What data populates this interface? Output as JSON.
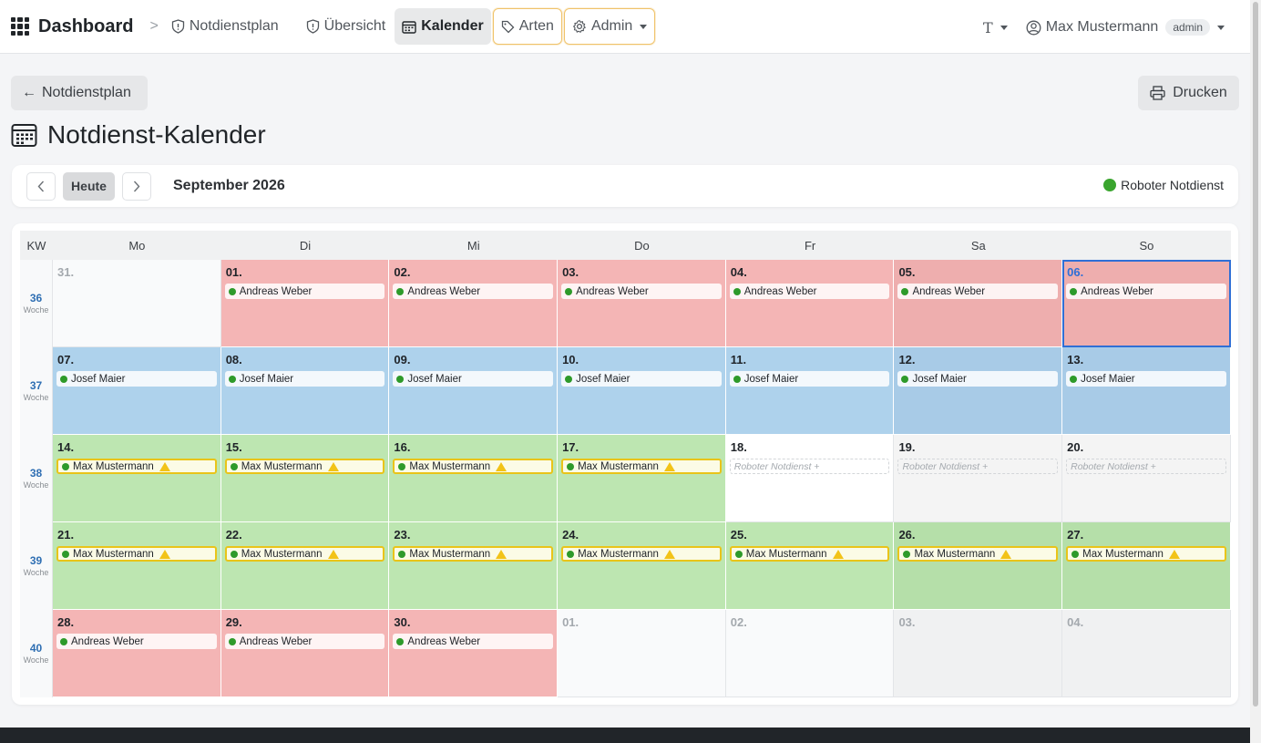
{
  "nav": {
    "brand": "Dashboard",
    "breadcrumb_sep": ">",
    "links": [
      "Notdienstplan",
      "Übersicht",
      "Kalender",
      "Arten",
      "Admin"
    ],
    "font_toggle": "T",
    "user_name": "Max Mustermann",
    "user_role": "admin"
  },
  "header": {
    "back_label": "Notdienstplan",
    "print_label": "Drucken",
    "title": "Notdienst-Kalender"
  },
  "toolbar": {
    "today_label": "Heute",
    "month_label": "September 2026",
    "legend_label": "Roboter Notdienst",
    "legend_color": "#3aa52e"
  },
  "calendar": {
    "kw_header": "KW",
    "day_headers": [
      "Mo",
      "Di",
      "Mi",
      "Do",
      "Fr",
      "Sa",
      "So"
    ],
    "week_label": "Woche",
    "weeks": [
      {
        "kw": "36",
        "days": [
          {
            "num": "31.",
            "style": "outside",
            "entry": null
          },
          {
            "num": "01.",
            "style": "red",
            "entry": "Andreas Weber"
          },
          {
            "num": "02.",
            "style": "red",
            "entry": "Andreas Weber"
          },
          {
            "num": "03.",
            "style": "red",
            "entry": "Andreas Weber"
          },
          {
            "num": "04.",
            "style": "red",
            "entry": "Andreas Weber"
          },
          {
            "num": "05.",
            "style": "red-we",
            "entry": "Andreas Weber"
          },
          {
            "num": "06.",
            "style": "red-we",
            "entry": "Andreas Weber",
            "today": true
          }
        ]
      },
      {
        "kw": "37",
        "days": [
          {
            "num": "07.",
            "style": "blue",
            "entry": "Josef Maier"
          },
          {
            "num": "08.",
            "style": "blue",
            "entry": "Josef Maier"
          },
          {
            "num": "09.",
            "style": "blue",
            "entry": "Josef Maier"
          },
          {
            "num": "10.",
            "style": "blue",
            "entry": "Josef Maier"
          },
          {
            "num": "11.",
            "style": "blue",
            "entry": "Josef Maier"
          },
          {
            "num": "12.",
            "style": "blue-we",
            "entry": "Josef Maier"
          },
          {
            "num": "13.",
            "style": "blue-we",
            "entry": "Josef Maier"
          }
        ]
      },
      {
        "kw": "38",
        "days": [
          {
            "num": "14.",
            "style": "green",
            "entry": "Max Mustermann",
            "warn": true
          },
          {
            "num": "15.",
            "style": "green",
            "entry": "Max Mustermann",
            "warn": true
          },
          {
            "num": "16.",
            "style": "green",
            "entry": "Max Mustermann",
            "warn": true
          },
          {
            "num": "17.",
            "style": "green",
            "entry": "Max Mustermann",
            "warn": true
          },
          {
            "num": "18.",
            "style": "white",
            "empty": "Roboter Notdienst +"
          },
          {
            "num": "19.",
            "style": "grey",
            "empty": "Roboter Notdienst +"
          },
          {
            "num": "20.",
            "style": "grey",
            "empty": "Roboter Notdienst +"
          }
        ]
      },
      {
        "kw": "39",
        "days": [
          {
            "num": "21.",
            "style": "green",
            "entry": "Max Mustermann",
            "warn": true
          },
          {
            "num": "22.",
            "style": "green",
            "entry": "Max Mustermann",
            "warn": true
          },
          {
            "num": "23.",
            "style": "green",
            "entry": "Max Mustermann",
            "warn": true
          },
          {
            "num": "24.",
            "style": "green",
            "entry": "Max Mustermann",
            "warn": true
          },
          {
            "num": "25.",
            "style": "green",
            "entry": "Max Mustermann",
            "warn": true
          },
          {
            "num": "26.",
            "style": "green-we",
            "entry": "Max Mustermann",
            "warn": true
          },
          {
            "num": "27.",
            "style": "green-we",
            "entry": "Max Mustermann",
            "warn": true
          }
        ]
      },
      {
        "kw": "40",
        "days": [
          {
            "num": "28.",
            "style": "red",
            "entry": "Andreas Weber"
          },
          {
            "num": "29.",
            "style": "red",
            "entry": "Andreas Weber"
          },
          {
            "num": "30.",
            "style": "red",
            "entry": "Andreas Weber"
          },
          {
            "num": "01.",
            "style": "outside",
            "entry": null
          },
          {
            "num": "02.",
            "style": "outside",
            "entry": null
          },
          {
            "num": "03.",
            "style": "outside-we",
            "entry": null
          },
          {
            "num": "04.",
            "style": "outside-we",
            "entry": null
          }
        ]
      }
    ]
  }
}
